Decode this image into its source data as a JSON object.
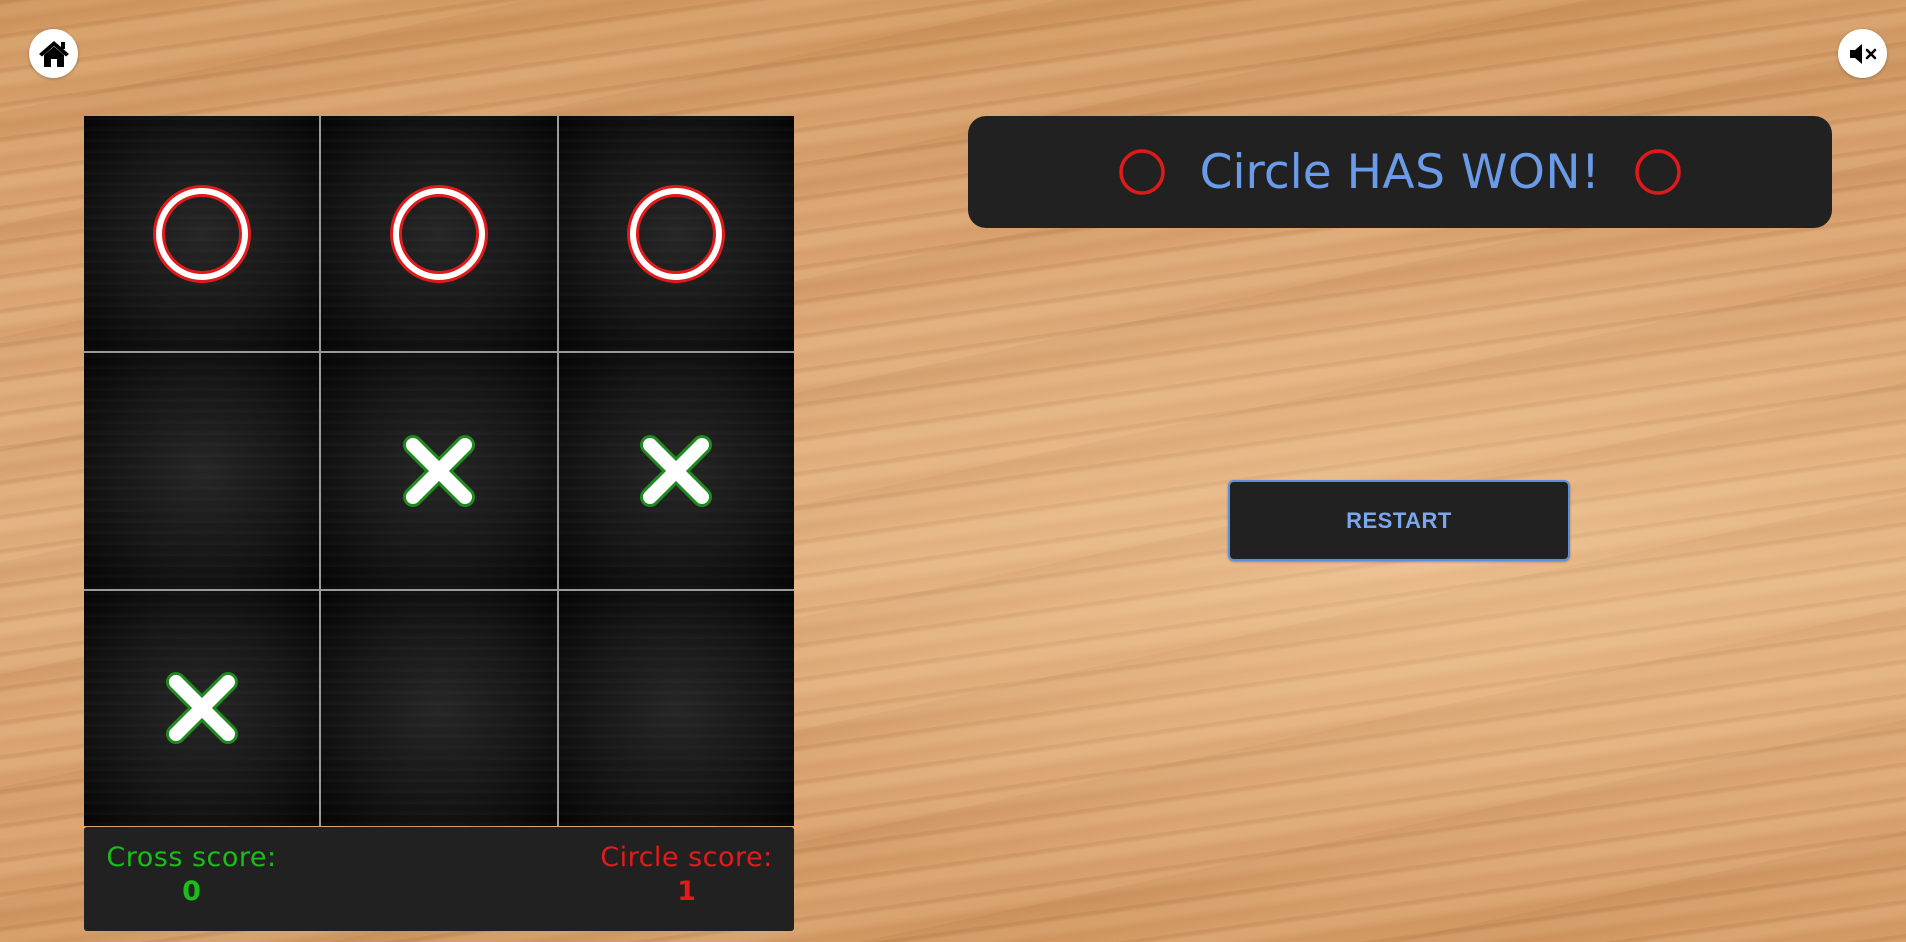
{
  "toolbar": {
    "home_icon": "home-icon",
    "mute_icon": "speaker-muted-icon"
  },
  "board": {
    "cells": [
      "O",
      "O",
      "O",
      "",
      "X",
      "X",
      "X",
      "",
      ""
    ]
  },
  "scores": {
    "cross_label": "Cross score:",
    "cross_value": "0",
    "circle_label": "Circle score:",
    "circle_value": "1"
  },
  "status": {
    "player": "Circle",
    "verdict": "HAS WON!"
  },
  "actions": {
    "restart_label": "RESTART"
  },
  "colors": {
    "circle": "#e01a1a",
    "cross": "#ffffff",
    "cross_outline": "#1f8a1f",
    "accent": "#6a9be8"
  }
}
